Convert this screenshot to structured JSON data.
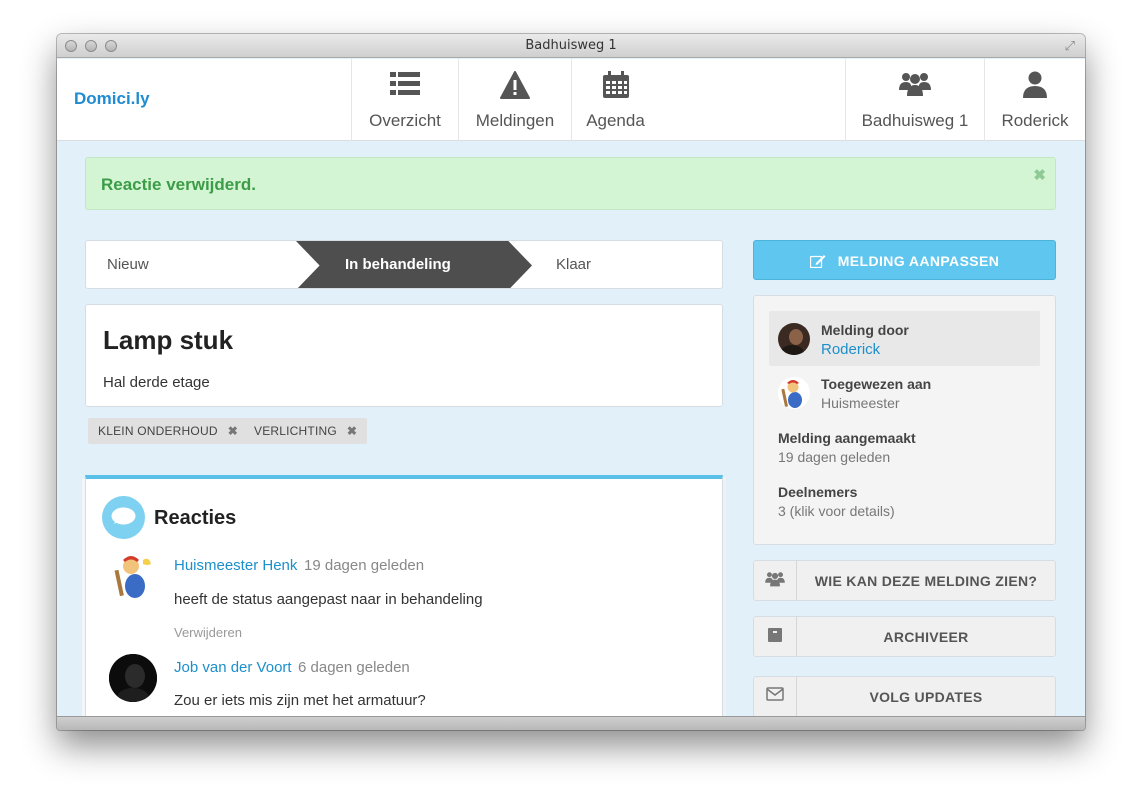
{
  "window": {
    "title": "Badhuisweg 1"
  },
  "brand": "Domici.ly",
  "nav": {
    "items": [
      {
        "label": "Overzicht",
        "icon": "list-icon"
      },
      {
        "label": "Meldingen",
        "icon": "warning-icon"
      },
      {
        "label": "Agenda",
        "icon": "calendar-icon"
      },
      {
        "label": "Badhuisweg 1",
        "icon": "group-icon"
      },
      {
        "label": "Roderick",
        "icon": "user-icon"
      }
    ]
  },
  "alert": {
    "text": "Reactie verwijderd.",
    "close": "✖"
  },
  "steps": {
    "items": [
      "Nieuw",
      "In behandeling",
      "Klaar"
    ],
    "active": "In behandeling"
  },
  "melding": {
    "title": "Lamp stuk",
    "location": "Hal derde etage",
    "tags": [
      "KLEIN ONDERHOUD",
      "VERLICHTING"
    ]
  },
  "reactions": {
    "title": "Reacties",
    "comments": [
      {
        "author": "Huismeester Henk",
        "time": "19 dagen geleden",
        "body": "heeft de status aangepast naar in behandeling",
        "action": "Verwijderen"
      },
      {
        "author": "Job van der Voort",
        "time": "6 dagen geleden",
        "body": "Zou er iets mis zijn met het armatuur?"
      }
    ]
  },
  "sidebar": {
    "edit_button": "MELDING AANPASSEN",
    "reported_by_label": "Melding door",
    "reported_by": "Roderick",
    "assigned_label": "Toegewezen aan",
    "assigned": "Huismeester",
    "created_label": "Melding aangemaakt",
    "created": "19 dagen geleden",
    "participants_label": "Deelnemers",
    "participants": "3 (klik voor details)",
    "actions": [
      {
        "label": "WIE KAN DEZE MELDING ZIEN?",
        "icon": "group-icon"
      },
      {
        "label": "ARCHIVEER",
        "icon": "archive-icon"
      },
      {
        "label": "VOLG UPDATES",
        "icon": "envelope-icon"
      }
    ]
  },
  "colors": {
    "accent": "#1d8fca",
    "primary_button": "#5fc6ef",
    "success": "#3c9c47",
    "active_step": "#4e4e4e"
  }
}
